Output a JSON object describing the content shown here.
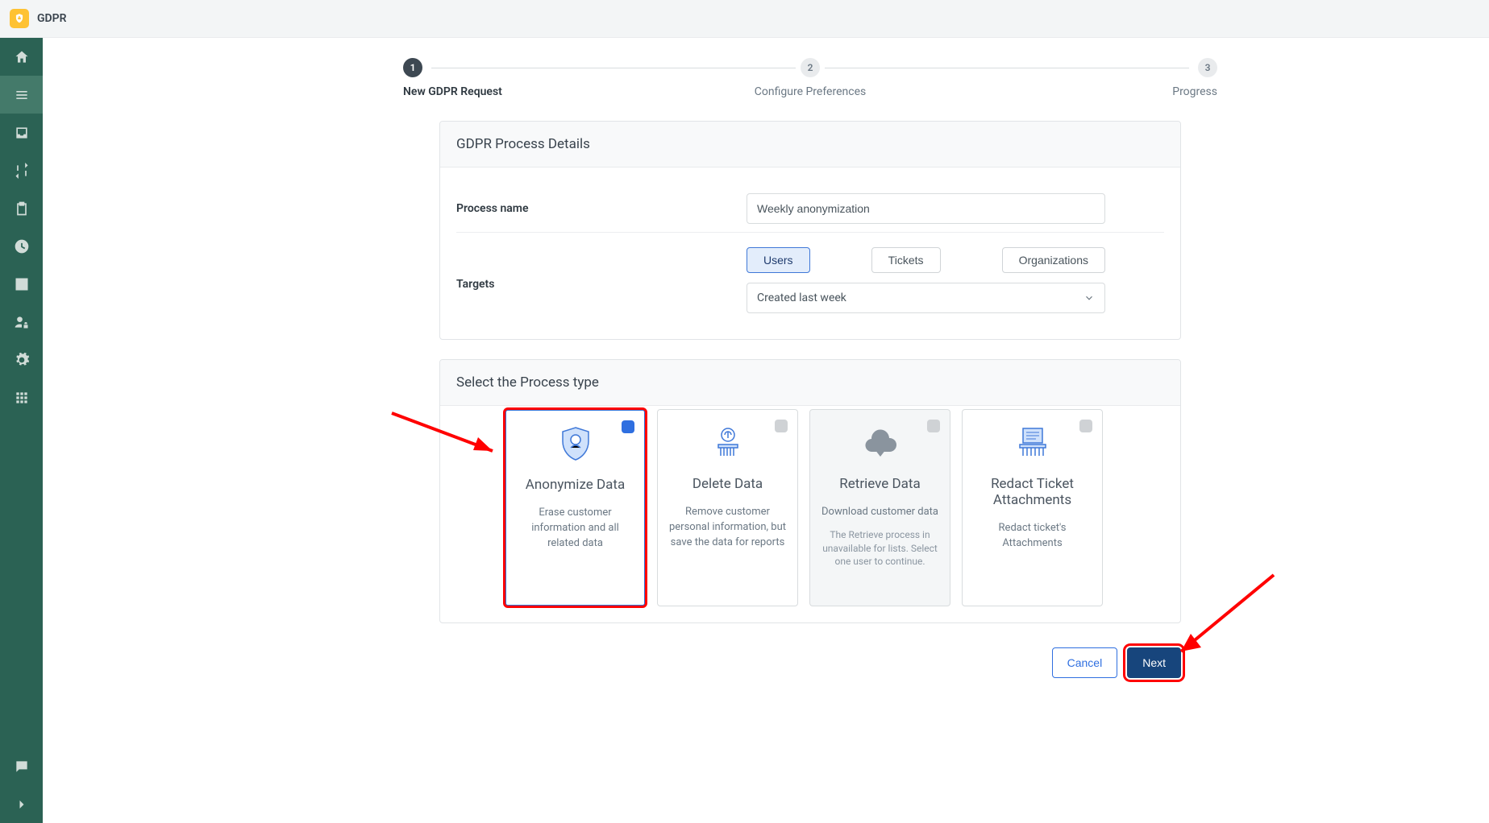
{
  "header": {
    "title": "GDPR"
  },
  "stepper": {
    "steps": [
      "New GDPR Request",
      "Configure Preferences",
      "Progress"
    ],
    "active_index": 0
  },
  "details_panel": {
    "title": "GDPR Process Details",
    "process_name_label": "Process name",
    "process_name_value": "Weekly anonymization",
    "targets_label": "Targets",
    "target_options": [
      "Users",
      "Tickets",
      "Organizations"
    ],
    "target_selected": "Users",
    "target_filter": "Created last week"
  },
  "process_type_panel": {
    "title": "Select the Process type",
    "cards": [
      {
        "title": "Anonymize Data",
        "desc": "Erase customer information and all related data",
        "selected": true,
        "disabled": false
      },
      {
        "title": "Delete Data",
        "desc": "Remove customer personal information, but save the data for reports",
        "selected": false,
        "disabled": false
      },
      {
        "title": "Retrieve Data",
        "desc": "Download customer data",
        "note": "The Retrieve process in unavailable for lists. Select one user to continue.",
        "selected": false,
        "disabled": true
      },
      {
        "title": "Redact Ticket Attachments",
        "desc": "Redact ticket's Attachments",
        "selected": false,
        "disabled": false
      }
    ]
  },
  "footer": {
    "cancel": "Cancel",
    "next": "Next"
  }
}
